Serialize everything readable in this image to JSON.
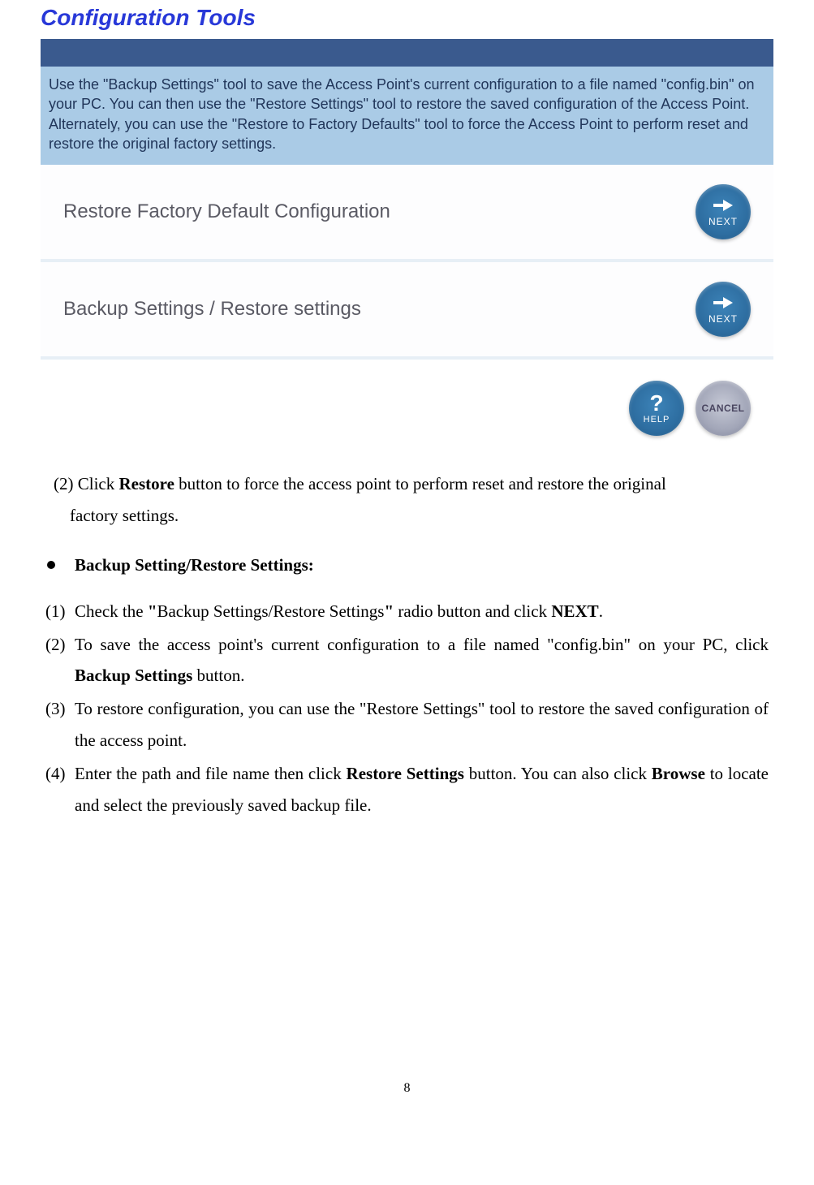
{
  "panel": {
    "title": "Configuration Tools",
    "description": "Use the \"Backup Settings\" tool to save the Access Point's current configuration to a file named \"config.bin\" on your PC. You can then use the \"Restore Settings\" tool to restore the saved configuration of the Access Point. Alternately, you can use the \"Restore to Factory Defaults\" tool to force the Access Point to perform reset and restore the original factory settings.",
    "options": [
      {
        "label": "Restore Factory Default Configuration",
        "button": "NEXT"
      },
      {
        "label": "Backup Settings  / Restore settings",
        "button": "NEXT"
      }
    ],
    "footer": {
      "help": "HELP",
      "cancel": "CANCEL"
    }
  },
  "doc": {
    "step2_prefix": "(2) Click ",
    "step2_bold": "Restore",
    "step2_suffix": " button to force the access point to perform reset and restore the original",
    "step2_line2": "factory settings.",
    "bullet_title": "Backup Setting/Restore Settings:",
    "items": {
      "i1": {
        "num": "(1)",
        "p1": "Check the ",
        "b1": "\"",
        "p2": "Backup Settings/Restore Settings",
        "b2": "\"",
        "p3": " radio button and click ",
        "b3": "NEXT",
        "p4": "."
      },
      "i2": {
        "num": "(2)",
        "p1": "To save the access point's current configuration to a file named \"config.bin\" on your PC, click ",
        "b1": "Backup Settings",
        "p2": " button."
      },
      "i3": {
        "num": "(3)",
        "p1": "To restore configuration, you can use the \"Restore Settings\" tool to restore the saved configuration of the access point."
      },
      "i4": {
        "num": "(4)",
        "p1": "Enter the path and file name then click ",
        "b1": "Restore Settings",
        "p2": " button. You can also click ",
        "b2": "Browse",
        "p3": " to locate and select the previously saved backup file."
      }
    }
  },
  "page_number": "8"
}
